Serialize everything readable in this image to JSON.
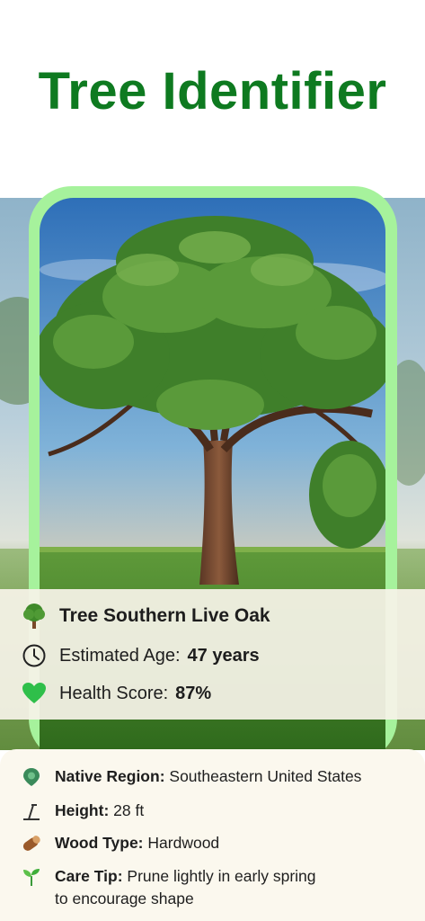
{
  "header": {
    "title": "Tree Identifier"
  },
  "summary": {
    "species": "Tree Southern Live Oak",
    "age_label": "Estimated Age:",
    "age_value": "47 years",
    "health_label": "Health Score:",
    "health_value": "87%"
  },
  "details": {
    "region_label": "Native Region:",
    "region_value": "Southeastern United States",
    "height_label": "Height:",
    "height_value": "28 ft",
    "wood_label": "Wood Type:",
    "wood_value": "Hardwood",
    "care_label": "Care Tip:",
    "care_value_line1": "Prune lightly in early spring",
    "care_value_line2": "to encourage shape"
  },
  "colors": {
    "title": "#0e7a20",
    "frame": "#a6f29c",
    "health_heart": "#2fbf4a"
  },
  "icons": [
    "tree-icon",
    "clock-icon",
    "heart-icon",
    "globe-pin-icon",
    "measure-icon",
    "wood-log-icon",
    "sprout-icon"
  ]
}
